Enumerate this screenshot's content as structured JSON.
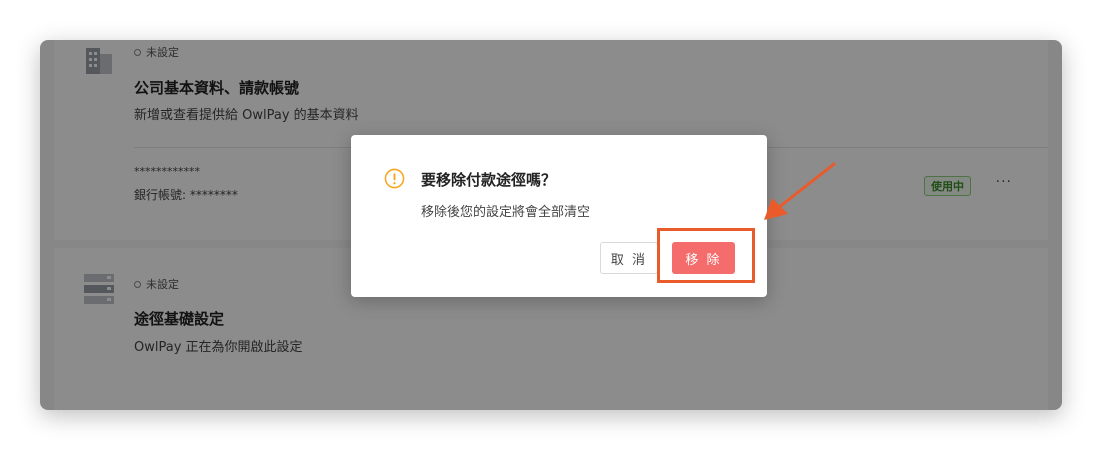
{
  "background_card1": {
    "status": "未設定",
    "title": "公司基本資料、請款帳號",
    "description": "新增或查看提供給 OwlPay 的基本資料",
    "bank_masked": "************",
    "bank_account": "銀行帳號: ********",
    "badge": "使用中",
    "more_label": "···",
    "icon": "building-icon"
  },
  "background_card2": {
    "status": "未設定",
    "title": "途徑基礎設定",
    "description": "OwlPay 正在為你開啟此設定",
    "icon": "server-icon"
  },
  "dialog": {
    "title": "要移除付款途徑嗎？",
    "message": "移除後您的設定將會全部清空",
    "cancel_label": "取 消",
    "confirm_label": "移 除",
    "icon": "warning-icon"
  },
  "colors": {
    "overlay": "rgba(0,0,0,0.45)",
    "warning": "#f5a623",
    "danger": "#f56c6c",
    "badge_green": "#3c8f2b",
    "annotation": "#ea5b2c"
  }
}
